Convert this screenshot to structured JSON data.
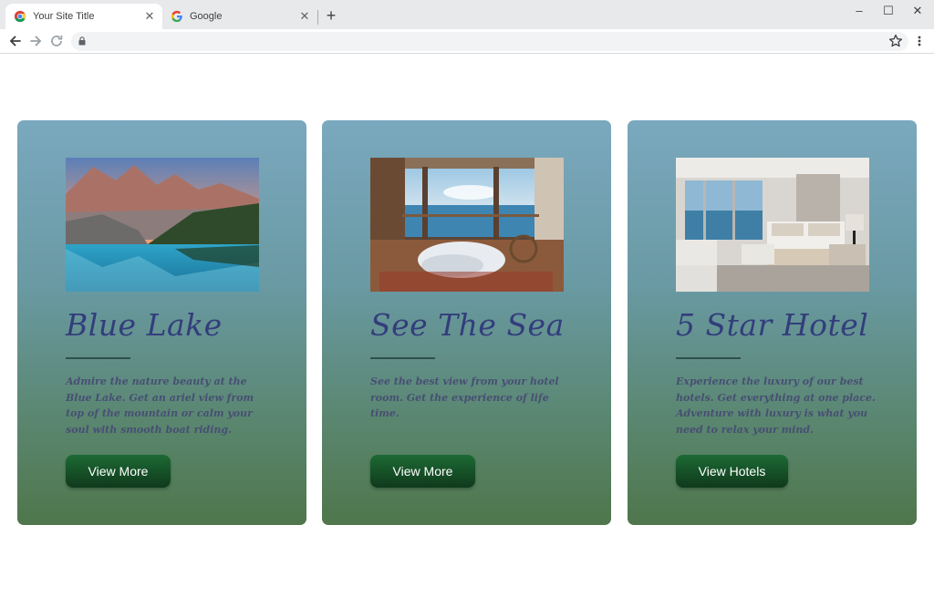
{
  "browser": {
    "tabs": [
      {
        "title": "Your Site Title",
        "active": true
      },
      {
        "title": "Google",
        "active": false
      }
    ],
    "icons": {
      "back": "arrow-left-icon",
      "forward": "arrow-right-icon",
      "reload": "reload-icon",
      "lock": "lock-icon",
      "bookmark": "star-icon",
      "menu": "kebab-menu-icon",
      "new_tab": "plus-icon"
    },
    "address": ""
  },
  "cards": [
    {
      "title": "Blue Lake",
      "text": "Admire the nature beauty at the Blue Lake. Get an ariel view from top of the mountain or calm your soul with smooth boat riding.",
      "button": "View More",
      "image": "mountain-lake-photo"
    },
    {
      "title": "See The Sea",
      "text": "See the best view from your hotel room. Get the experience of life time.",
      "button": "View More",
      "image": "sea-view-room-photo"
    },
    {
      "title": "5 Star Hotel",
      "text": "Experience the luxury of our best hotels. Get everything at one place. Adventure with luxury is what you need to relax your mind.",
      "button": "View Hotels",
      "image": "hotel-room-photo"
    }
  ],
  "colors": {
    "card_top": "#7aa8be",
    "card_bottom": "#4f764b",
    "title": "#333d7c",
    "button": "#0f3a1c"
  }
}
